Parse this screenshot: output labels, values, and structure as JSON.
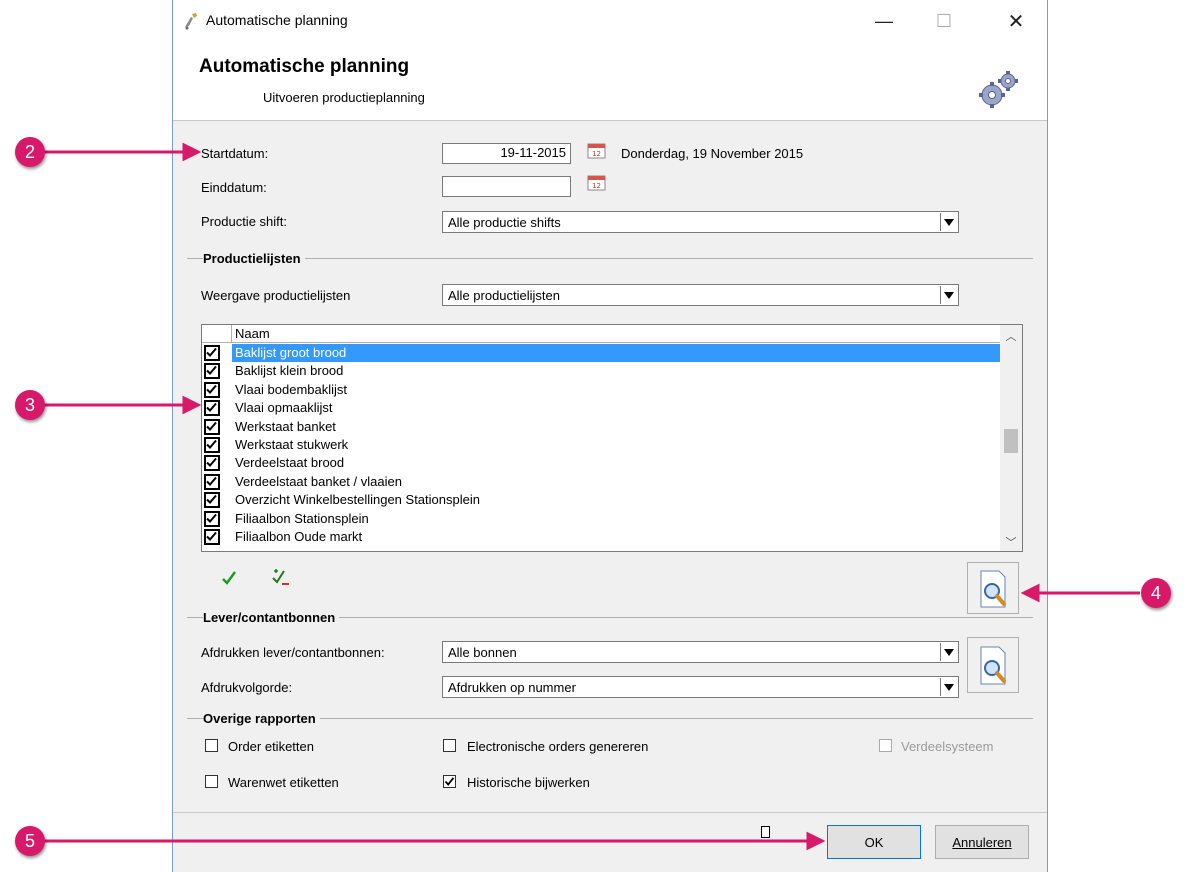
{
  "window": {
    "title": "Automatische planning",
    "minimize": "—",
    "maximize": "☐",
    "close": "✕"
  },
  "header": {
    "title": "Automatische planning",
    "subtitle": "Uitvoeren productieplanning"
  },
  "dates": {
    "start_label": "Startdatum:",
    "start_value": "19-11-2015",
    "start_text": "Donderdag, 19 November 2015",
    "end_label": "Einddatum:",
    "end_value": ""
  },
  "shift": {
    "label": "Productie shift:",
    "value": "Alle productie shifts"
  },
  "productielijsten": {
    "section": "Productielijsten",
    "view_label": "Weergave productielijsten",
    "view_value": "Alle productielijsten",
    "column_name": "Naam",
    "items": [
      {
        "name": "Baklijst groot brood",
        "checked": true,
        "selected": true
      },
      {
        "name": "Baklijst klein brood",
        "checked": true
      },
      {
        "name": "Vlaai bodembaklijst",
        "checked": true
      },
      {
        "name": "Vlaai opmaaklijst",
        "checked": true
      },
      {
        "name": "Werkstaat banket",
        "checked": true
      },
      {
        "name": "Werkstaat stukwerk",
        "checked": true
      },
      {
        "name": "Verdeelstaat brood",
        "checked": true
      },
      {
        "name": "Verdeelstaat banket / vlaaien",
        "checked": true
      },
      {
        "name": "Overzicht Winkelbestellingen Stationsplein",
        "checked": true
      },
      {
        "name": "Filiaalbon Stationsplein",
        "checked": true
      },
      {
        "name": "Filiaalbon Oude markt",
        "checked": true
      }
    ]
  },
  "bonnen": {
    "section": "Lever/contantbonnen",
    "print_label": "Afdrukken lever/contantbonnen:",
    "print_value": "Alle bonnen",
    "order_label": "Afdrukvolgorde:",
    "order_value": "Afdrukken op nummer"
  },
  "overige": {
    "section": "Overige rapporten",
    "order_etiketten": "Order etiketten",
    "warenwet_etiketten": "Warenwet etiketten",
    "electronische_orders": "Electronische orders genereren",
    "historische": "Historische bijwerken",
    "verdeelsysteem": "Verdeelsysteem"
  },
  "buttons": {
    "ok": "OK",
    "cancel": "Annuleren"
  },
  "annotations": [
    "2",
    "3",
    "4",
    "5"
  ],
  "colors": {
    "accent": "#d8196a",
    "selection": "#3399ff"
  }
}
